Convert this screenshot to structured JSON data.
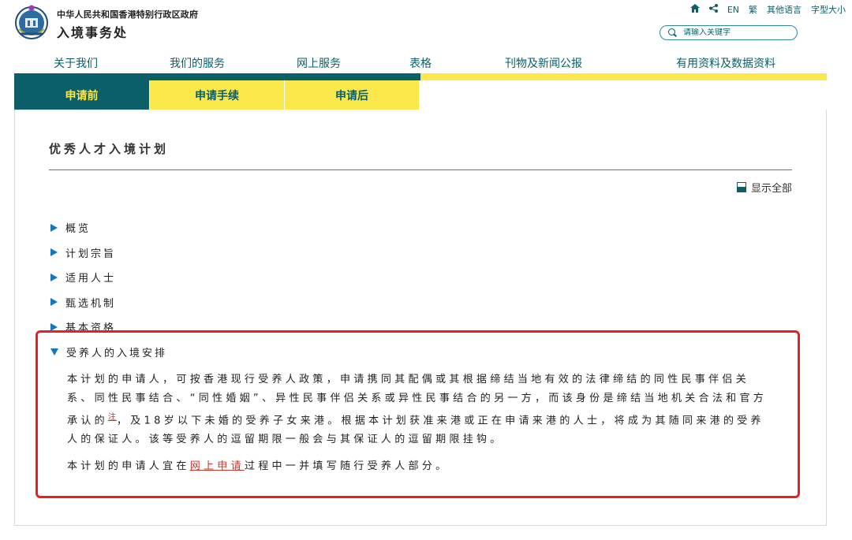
{
  "header": {
    "gov_name": "中华人民共和国香港特别行政区政府",
    "dept_name": "入境事务处",
    "toplinks": {
      "home_icon": "home-icon",
      "share_icon": "share-icon",
      "en": "EN",
      "trad": "繁",
      "other_lang": "其他语言",
      "font_size": "字型大小"
    },
    "search": {
      "placeholder": "请输入关键字"
    }
  },
  "main_nav": [
    {
      "label": "关于我们"
    },
    {
      "label": "我们的服务"
    },
    {
      "label": "网上服务"
    },
    {
      "label": "表格"
    },
    {
      "label": "刊物及新闻公报"
    },
    {
      "label": "有用资料及数据资料"
    }
  ],
  "sub_tabs": [
    {
      "label": "申请前",
      "active": true
    },
    {
      "label": "申请手续",
      "active": false
    },
    {
      "label": "申请后",
      "active": false
    }
  ],
  "page": {
    "title": "优秀人才入境计划",
    "show_all": "显示全部"
  },
  "accordion": [
    {
      "label": "概览",
      "expanded": false
    },
    {
      "label": "计划宗旨",
      "expanded": false
    },
    {
      "label": "适用人士",
      "expanded": false
    },
    {
      "label": "甄选机制",
      "expanded": false
    },
    {
      "label": "基本资格",
      "expanded": false
    },
    {
      "label": "受养人的入境安排",
      "expanded": true
    }
  ],
  "expanded": {
    "para1_a": "本计划的申请人，可按香港现行受养人政策，申请携同其配偶或其根据缔结当地有效的法律缔结的同性民事伴侣关系、同性民事结合、“同性婚姻”、异性民事伴侣关系或异性民事结合的另一方，而该身份是缔结当地机关合法和官方承认的",
    "para1_note": "注",
    "para1_b": "，及18岁以下未婚的受养子女来港。根据本计划获准来港或正在申请来港的人士，将成为其随同来港的受养人的保证人。该等受养人的逗留期限一般会与其保证人的逗留期限挂钩。",
    "para2_a": "本计划的申请人宜在",
    "para2_link": "网上申请",
    "para2_b": "过程中一并填写随行受养人部分。"
  },
  "colors": {
    "primary": "#0b5f68",
    "accent": "#fbe84b",
    "bullet": "#1976b7",
    "highlight": "#e82020",
    "link": "#c0392b"
  }
}
